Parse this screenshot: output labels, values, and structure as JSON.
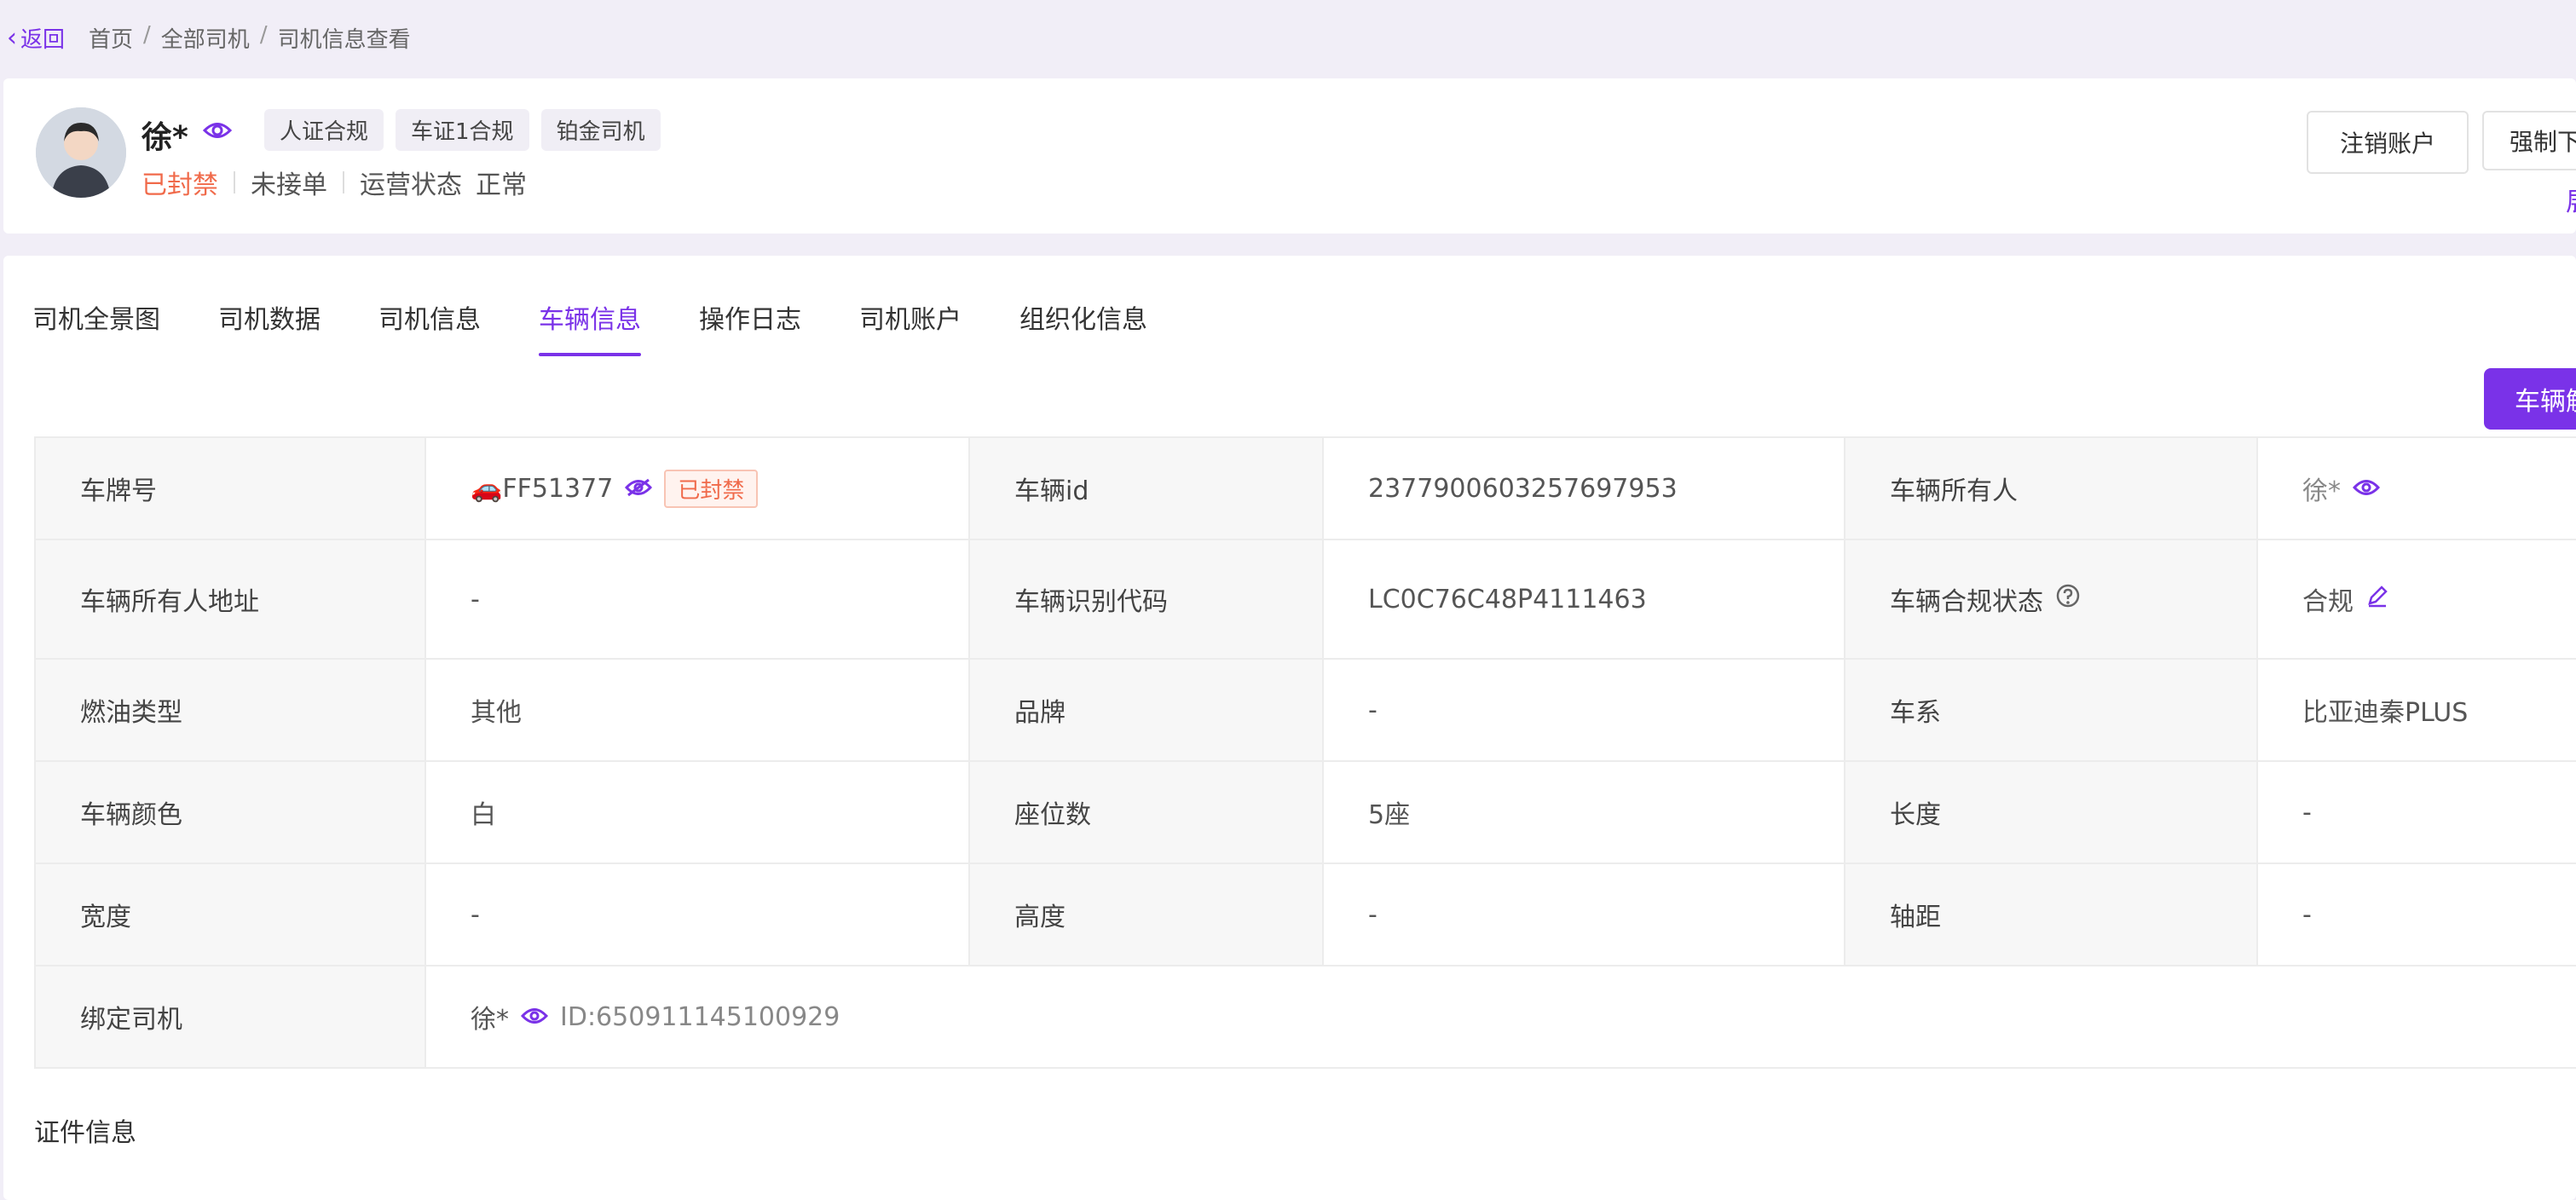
{
  "breadcrumb": {
    "back_label": "返回",
    "items": [
      "首页",
      "全部司机",
      "司机信息查看"
    ]
  },
  "driver": {
    "name": "徐*",
    "tags": [
      "人证合规",
      "车证1合规",
      "铂金司机"
    ],
    "status": "已封禁",
    "order_state": "未接单",
    "operation_label": "运营状态",
    "operation_value": "正常"
  },
  "actions": {
    "logout": "注销账户",
    "other": "强制下线",
    "more": "展"
  },
  "tabs": [
    "司机全景图",
    "司机数据",
    "司机信息",
    "车辆信息",
    "操作日志",
    "司机账户",
    "组织化信息"
  ],
  "active_tab": 3,
  "primary_button": "车辆解绑",
  "vehicle": {
    "rows": [
      [
        {
          "label": "车牌号",
          "value": "🚗FF51377",
          "badge": "已封禁"
        },
        {
          "label": "车辆id",
          "value": "2377900603257697953"
        },
        {
          "label": "车辆所有人",
          "value": "徐*"
        }
      ],
      [
        {
          "label": "车辆所有人地址",
          "value": "-"
        },
        {
          "label": "车辆识别代码",
          "value": "LC0C76C48P4111463"
        },
        {
          "label": "车辆合规状态",
          "value": "合规"
        }
      ],
      [
        {
          "label": "燃油类型",
          "value": "其他"
        },
        {
          "label": "品牌",
          "value": "-"
        },
        {
          "label": "车系",
          "value": "比亚迪秦PLUS"
        }
      ],
      [
        {
          "label": "车辆颜色",
          "value": "白"
        },
        {
          "label": "座位数",
          "value": "5座"
        },
        {
          "label": "长度",
          "value": "-"
        }
      ],
      [
        {
          "label": "宽度",
          "value": "-"
        },
        {
          "label": "高度",
          "value": "-"
        },
        {
          "label": "轴距",
          "value": "-"
        }
      ]
    ],
    "bound_driver": {
      "label": "绑定司机",
      "name": "徐*",
      "id": "ID:650911145100929"
    }
  },
  "section_title": "证件信息",
  "colors": {
    "accent": "#7a32e8",
    "danger": "#f06a4a"
  }
}
